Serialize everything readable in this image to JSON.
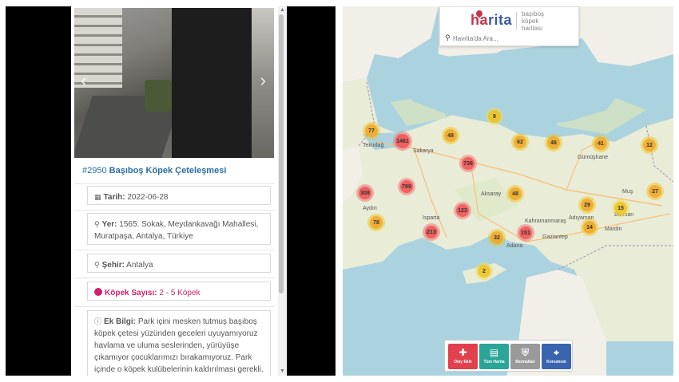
{
  "report": {
    "number": "#2950",
    "title": "Başıboş Köpek Çeteleşmesi",
    "date_label": "Tarih:",
    "date_value": "2022-06-28",
    "location_label": "Yer:",
    "location_value": "1565. Sokak, Meydankavağı Mahallesi, Muratpaşa, Antalya, Türkiye",
    "city_label": "Şehir:",
    "city_value": "Antalya",
    "dog_count_label": "Köpek Sayısı:",
    "dog_count_value": "2 - 5 Köpek",
    "extra_label": "Ek Bilgi:",
    "extra_value": "Park içini mesken tutmuş başıboş köpek çetesi yüzünden geceleri uyuyamıyoruz havlama ve uluma seslerinden, yürüyüşe çıkamıyor çocuklarımızı bırakamıyoruz. Park içinde o köpek kulübelerinin kaldırılması gerekli."
  },
  "gallery": {
    "prev_icon": "chevron-left-icon",
    "next_icon": "chevron-right-icon"
  },
  "logo": {
    "brand_start": "ha",
    "brand_end": "rita",
    "tagline_1": "başıboş",
    "tagline_2": "köpek",
    "tagline_3": "haritası"
  },
  "search": {
    "placeholder": "Havrita'da Ara..."
  },
  "clusters": [
    {
      "label": "9",
      "tone": "yel"
    },
    {
      "label": "77",
      "tone": "org"
    },
    {
      "label": "1461",
      "tone": "red"
    },
    {
      "label": "48",
      "tone": "org"
    },
    {
      "label": "62",
      "tone": "org"
    },
    {
      "label": "46",
      "tone": "org"
    },
    {
      "label": "41",
      "tone": "org"
    },
    {
      "label": "12",
      "tone": "org"
    },
    {
      "label": "736",
      "tone": "red"
    },
    {
      "label": "308",
      "tone": "red"
    },
    {
      "label": "799",
      "tone": "red"
    },
    {
      "label": "48",
      "tone": "org"
    },
    {
      "label": "29",
      "tone": "org"
    },
    {
      "label": "27",
      "tone": "org"
    },
    {
      "label": "15",
      "tone": "yel"
    },
    {
      "label": "123",
      "tone": "red"
    },
    {
      "label": "78",
      "tone": "org"
    },
    {
      "label": "14",
      "tone": "org"
    },
    {
      "label": "213",
      "tone": "red"
    },
    {
      "label": "32",
      "tone": "org"
    },
    {
      "label": "151",
      "tone": "red"
    },
    {
      "label": "2",
      "tone": "yel"
    }
  ],
  "places": [
    "Tekirdağ",
    "Sakarya",
    "Aksaray",
    "Isparta",
    "Aydın",
    "Kahramanmaraş",
    "Adıyaman",
    "Gaziantep",
    "Batman",
    "Mardin",
    "Adana",
    "Gümüşhane",
    "Muş"
  ],
  "toolbar": {
    "btn1": "Olay Ekle",
    "btn2": "Tüm Harita",
    "btn3": "Barınaklar",
    "btn4": "Konumum"
  },
  "colors": {
    "brand_red": "#c8334b",
    "brand_blue": "#3d5a9e",
    "link_blue": "#2a6ea6",
    "dog_pink": "#d3206a"
  }
}
